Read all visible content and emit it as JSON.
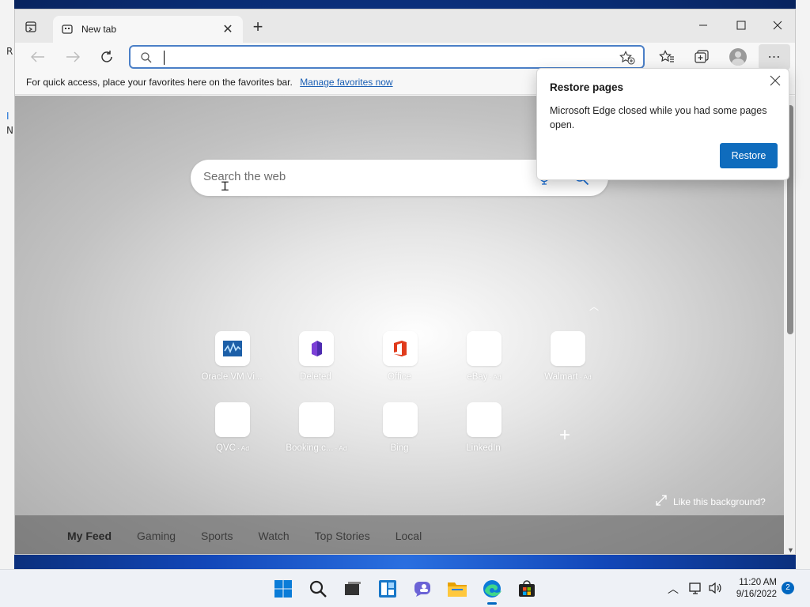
{
  "desktop": {
    "left_glyphs": [
      "R",
      "I",
      "N"
    ]
  },
  "tab": {
    "title": "New tab"
  },
  "address_bar": {
    "value": "",
    "placeholder": ""
  },
  "favorites_bar": {
    "message": "For quick access, place your favorites here on the favorites bar.",
    "link": "Manage favorites now"
  },
  "new_tab_page": {
    "search_placeholder": "Search the web",
    "tiles": [
      {
        "label": "Oracle VM Vi...",
        "ad": ""
      },
      {
        "label": "Deleted",
        "ad": ""
      },
      {
        "label": "Office",
        "ad": ""
      },
      {
        "label": "eBay",
        "ad": "· Ad"
      },
      {
        "label": "Walmart",
        "ad": "· Ad"
      },
      {
        "label": "QVC",
        "ad": "· Ad"
      },
      {
        "label": "Booking.c...",
        "ad": "· Ad"
      },
      {
        "label": "Bing",
        "ad": ""
      },
      {
        "label": "LinkedIn",
        "ad": ""
      }
    ],
    "add_tile": "+",
    "like_background": "Like this background?",
    "feed_tabs": [
      "My Feed",
      "Gaming",
      "Sports",
      "Watch",
      "Top Stories",
      "Local"
    ]
  },
  "restore_popup": {
    "title": "Restore pages",
    "body": "Microsoft Edge closed while you had some pages open.",
    "button": "Restore"
  },
  "taskbar": {
    "apps": [
      "start-icon",
      "search-icon",
      "task-view-icon",
      "widgets-icon",
      "chat-icon",
      "file-explorer-icon",
      "edge-icon",
      "store-icon"
    ],
    "time": "11:20 AM",
    "date": "9/16/2022",
    "notification_count": "2"
  },
  "colors": {
    "accent": "#0f6cbd",
    "address_border": "#4b7fc7",
    "link": "#1a5fb4"
  }
}
